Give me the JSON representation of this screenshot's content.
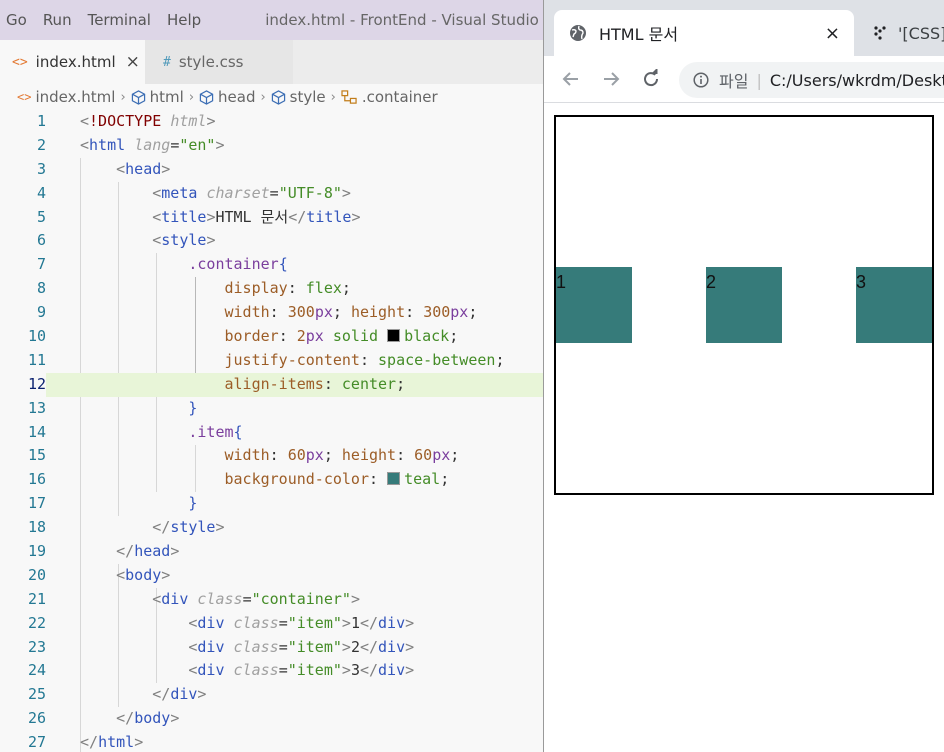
{
  "vscode": {
    "menu": [
      "Go",
      "Run",
      "Terminal",
      "Help"
    ],
    "window_title": "index.html - FrontEnd - Visual Studio Code",
    "tabs": [
      {
        "icon": "<>",
        "label": "index.html",
        "close": "×"
      },
      {
        "icon": "#",
        "label": "style.css"
      }
    ],
    "breadcrumb": [
      "index.html",
      "html",
      "head",
      "style",
      ".container"
    ],
    "code_lines": [
      {
        "n": "1"
      },
      {
        "n": "2"
      },
      {
        "n": "3"
      },
      {
        "n": "4"
      },
      {
        "n": "5"
      },
      {
        "n": "6"
      },
      {
        "n": "7"
      },
      {
        "n": "8"
      },
      {
        "n": "9"
      },
      {
        "n": "10"
      },
      {
        "n": "11"
      },
      {
        "n": "12"
      },
      {
        "n": "13"
      },
      {
        "n": "14"
      },
      {
        "n": "15"
      },
      {
        "n": "16"
      },
      {
        "n": "17"
      },
      {
        "n": "18"
      },
      {
        "n": "19"
      },
      {
        "n": "20"
      },
      {
        "n": "21"
      },
      {
        "n": "22"
      },
      {
        "n": "23"
      },
      {
        "n": "24"
      },
      {
        "n": "25"
      },
      {
        "n": "26"
      },
      {
        "n": "27"
      }
    ],
    "current_line": 12,
    "swatch_colors": {
      "black": "#000000",
      "teal": "#367b7a"
    }
  },
  "browser": {
    "tabs": [
      {
        "label": "HTML 문서",
        "close": "×"
      },
      {
        "label": "'[CSS]"
      }
    ],
    "address": {
      "site_label": "파일",
      "separator": "|",
      "url": "C:/Users/wkrdm/Desktop/FrontEnd/index.html"
    },
    "items": [
      "1",
      "2",
      "3"
    ],
    "item_color": "#367b7a"
  }
}
